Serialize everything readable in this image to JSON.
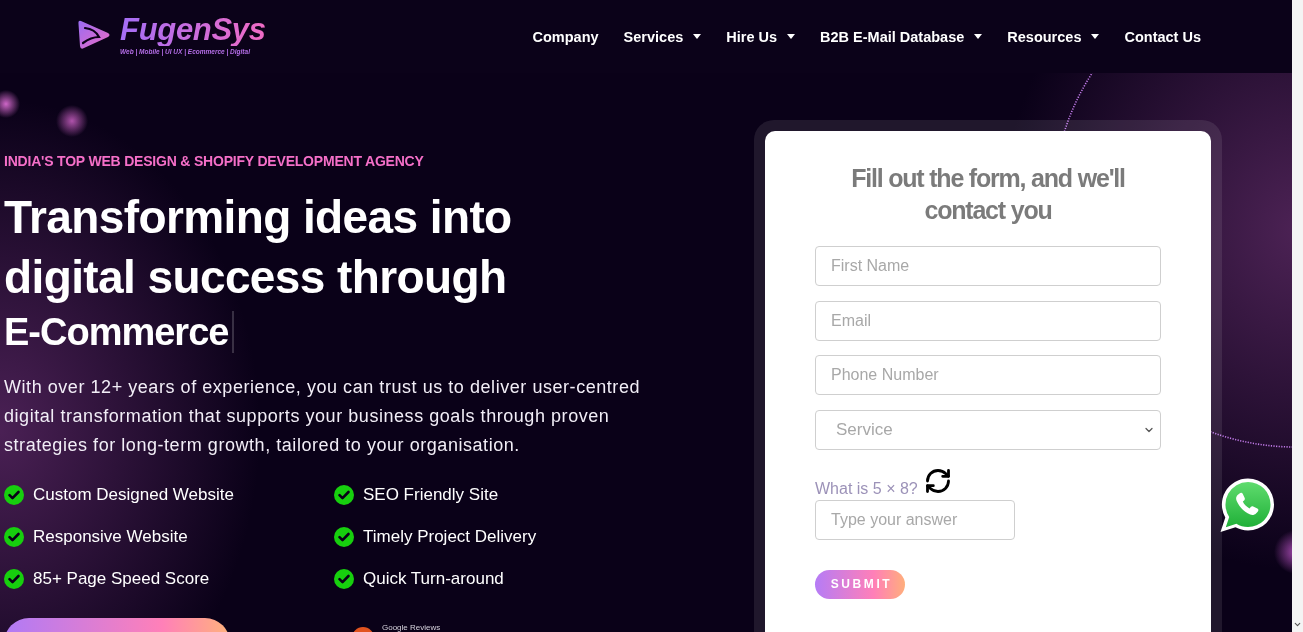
{
  "header": {
    "logo": {
      "name": "FugenSys",
      "tagline": "Web | Mobile | UI UX | Ecommerce | Digital"
    },
    "nav": [
      {
        "label": "Company",
        "dropdown": false
      },
      {
        "label": "Services",
        "dropdown": true
      },
      {
        "label": "Hire Us",
        "dropdown": true
      },
      {
        "label": "B2B E-Mail Database",
        "dropdown": true
      },
      {
        "label": "Resources",
        "dropdown": true
      },
      {
        "label": "Contact Us",
        "dropdown": false
      }
    ]
  },
  "hero": {
    "eyebrow": "INDIA'S TOP WEB DESIGN & SHOPIFY DEVELOPMENT AGENCY",
    "headline": "Transforming ideas into digital success through",
    "typed_word": "E-Commerce",
    "description": "With over 12+ years of experience, you can trust us to deliver user-centred digital transformation that supports your business goals through proven strategies for long-term growth, tailored to your organisation.",
    "features": [
      "Custom Designed Website",
      "SEO Friendly Site",
      "Responsive Website",
      "Timely Project Delivery",
      "85+ Page Speed Score",
      "Quick Turn-around"
    ],
    "reviews_label": "Google Reviews"
  },
  "form": {
    "title": "Fill out the form, and we'll contact you",
    "fields": [
      {
        "placeholder": "First Name"
      },
      {
        "placeholder": "Email"
      },
      {
        "placeholder": "Phone Number"
      }
    ],
    "service_select": {
      "placeholder": "Service"
    },
    "captcha": {
      "question": "What is 5 × 8?",
      "answer_placeholder": "Type your answer"
    },
    "submit": "SUBMIT"
  }
}
